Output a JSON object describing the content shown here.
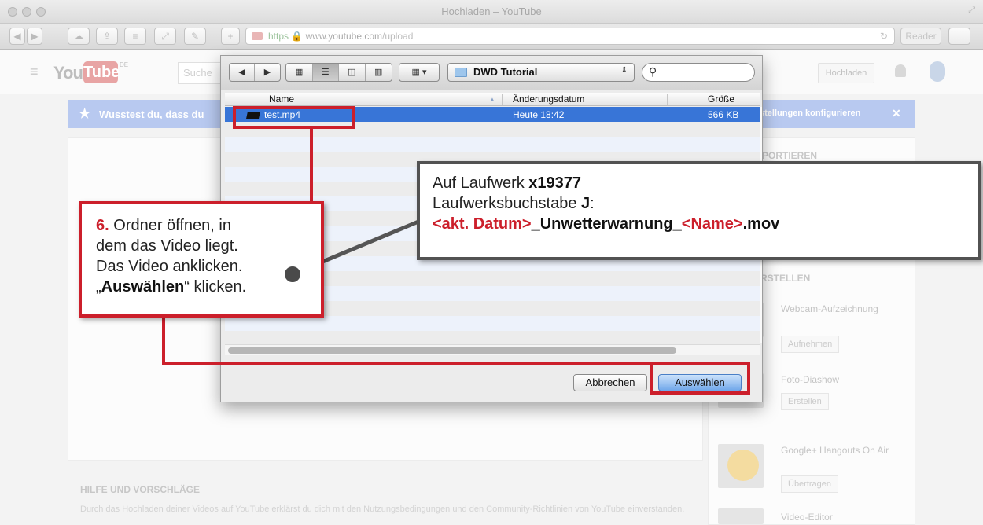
{
  "window": {
    "title": "Hochladen – YouTube",
    "url_scheme": "https",
    "url_host": "www.youtube.com",
    "url_path": "/upload",
    "reader_label": "Reader"
  },
  "youtube": {
    "logo_you": "You",
    "logo_tube": "Tube",
    "logo_region": "DE",
    "search_placeholder": "Suche",
    "upload_button": "Hochladen",
    "banner_text": "Wusstest du, dass du",
    "banner_right": "stellungen konfigurieren",
    "side_importieren": "MPORTIEREN",
    "side_erstellen": "ERSTELLEN",
    "side_items": [
      {
        "title": "Webcam-Aufzeichnung",
        "button": "Aufnehmen"
      },
      {
        "title": "Foto-Diashow",
        "button": "Erstellen"
      },
      {
        "title": "Google+ Hangouts On Air",
        "button": "Übertragen"
      },
      {
        "title": "Video-Editor",
        "button": ""
      }
    ],
    "help_title": "HILFE UND VORSCHLÄGE",
    "help_text": "Durch das Hochladen deiner Videos auf YouTube erklärst du dich mit den Nutzungsbedingungen und den Community-Richtlinien von YouTube einverstanden."
  },
  "dialog": {
    "current_folder": "DWD Tutorial",
    "columns": {
      "name": "Name",
      "date": "Änderungsdatum",
      "size": "Größe"
    },
    "files": [
      {
        "name": "test.mp4",
        "date": "Heute 18:42",
        "size": "566 KB",
        "selected": true
      }
    ],
    "cancel_label": "Abbrechen",
    "select_label": "Auswählen"
  },
  "callout": {
    "step_number": "6.",
    "line1": " Ordner öffnen, in",
    "line2": "dem das Video liegt.",
    "line3": "Das Video anklicken.",
    "line4_prefix": "„",
    "line4_bold": "Auswählen",
    "line4_suffix": "“ klicken."
  },
  "info": {
    "line1_prefix": "Auf Laufwerk ",
    "line1_bold": "x19377",
    "line2_prefix": "Laufwerksbuchstabe ",
    "line2_bold": "J",
    "line2_suffix": ":",
    "line3_red1": "<akt. Datum>",
    "line3_bold1": "_Unwetterwarnung_",
    "line3_red2": "<Name>",
    "line3_bold2": ".mov"
  },
  "colors": {
    "annotation_red": "#cc1f2b",
    "selection_blue": "#3875d7",
    "info_border": "#525252"
  }
}
